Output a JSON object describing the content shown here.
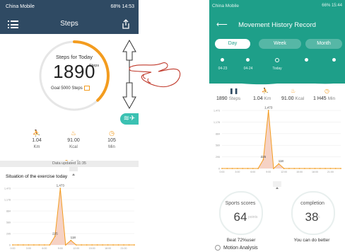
{
  "colors": {
    "nav": "#2f4a63",
    "accent": "#f39c1f",
    "teal": "#1e9f89",
    "run_button": "#3bc1b2"
  },
  "left": {
    "status": {
      "carrier": "China Mobile",
      "right": "68%  14:53"
    },
    "nav": {
      "title": "Steps",
      "menu_icon": "menu-icon",
      "share_icon": "share-icon"
    },
    "ring": {
      "heading": "Steps for Today",
      "steps": "1890",
      "unit": "Steps",
      "goal": "Goal 5000 Steps",
      "progress": 0.378
    },
    "metrics": [
      {
        "icon": "run-icon",
        "value": "1.04",
        "unit": "Km"
      },
      {
        "icon": "flame-icon",
        "value": "91.00",
        "unit": "Kcal"
      },
      {
        "icon": "clock-icon",
        "value": "105",
        "unit": "Min"
      }
    ],
    "updated": "Data updated 11:35",
    "section_title": "Situation of the exercise today",
    "chart_data": {
      "type": "area",
      "x": [
        0,
        1,
        2,
        3,
        4,
        5,
        6,
        7,
        8,
        9,
        10,
        11,
        12,
        13,
        14,
        15,
        16,
        17,
        18,
        19,
        20,
        21,
        22,
        23
      ],
      "values": [
        0,
        0,
        0,
        0,
        0,
        0,
        0,
        0,
        225,
        1473,
        0,
        118,
        0,
        0,
        0,
        0,
        0,
        0,
        0,
        0,
        0,
        0,
        0,
        0
      ],
      "peak_labels": [
        "225",
        "1,473",
        "118"
      ],
      "y_ticks": [
        "1,473",
        "1,178",
        "884",
        "589",
        "295",
        "0"
      ],
      "x_ticks": [
        "0:00",
        "3:00",
        "6:00",
        "9:00",
        "12:00",
        "15:00",
        "18:00",
        "21:00"
      ]
    }
  },
  "right": {
    "status": {
      "carrier": "China Mobile",
      "right": "66%  15:44"
    },
    "title": "Movement History Record",
    "tabs": [
      "Day",
      "Week",
      "Month"
    ],
    "days": [
      "04-23",
      "04-24",
      "Today",
      "",
      ""
    ],
    "metrics": [
      {
        "icon": "footsteps-icon",
        "value": "1890",
        "unit": "Steps"
      },
      {
        "icon": "run-icon",
        "value": "1.04",
        "unit": "Km"
      },
      {
        "icon": "flame-icon",
        "value": "91.00",
        "unit": "Kcal"
      },
      {
        "icon": "clock-icon",
        "value": "1 H45",
        "unit": "Min"
      }
    ],
    "chart_data": {
      "type": "area",
      "x": [
        0,
        1,
        2,
        3,
        4,
        5,
        6,
        7,
        8,
        9,
        10,
        11,
        12,
        13,
        14,
        15,
        16,
        17,
        18,
        19,
        20,
        21,
        22,
        23
      ],
      "values": [
        0,
        0,
        0,
        0,
        0,
        0,
        0,
        0,
        225,
        1473,
        0,
        118,
        0,
        0,
        0,
        0,
        0,
        0,
        0,
        0,
        0,
        0,
        0,
        0
      ],
      "peak_labels": [
        "225",
        "1,473",
        "118"
      ],
      "y_ticks": [
        "1,473",
        "1,178",
        "884",
        "589",
        "295",
        "0"
      ],
      "x_ticks": [
        "0:00",
        "3:00",
        "6:00",
        "9:00",
        "12:00",
        "15:00",
        "18:00",
        "21:00"
      ]
    },
    "scores": [
      {
        "label": "Sports scores",
        "value": "64",
        "unit": "points",
        "footer": "Beat 72%user"
      },
      {
        "label": "completion",
        "value": "38",
        "unit": "%",
        "footer": "You can do better"
      }
    ],
    "motion": "Motion Analysis"
  }
}
